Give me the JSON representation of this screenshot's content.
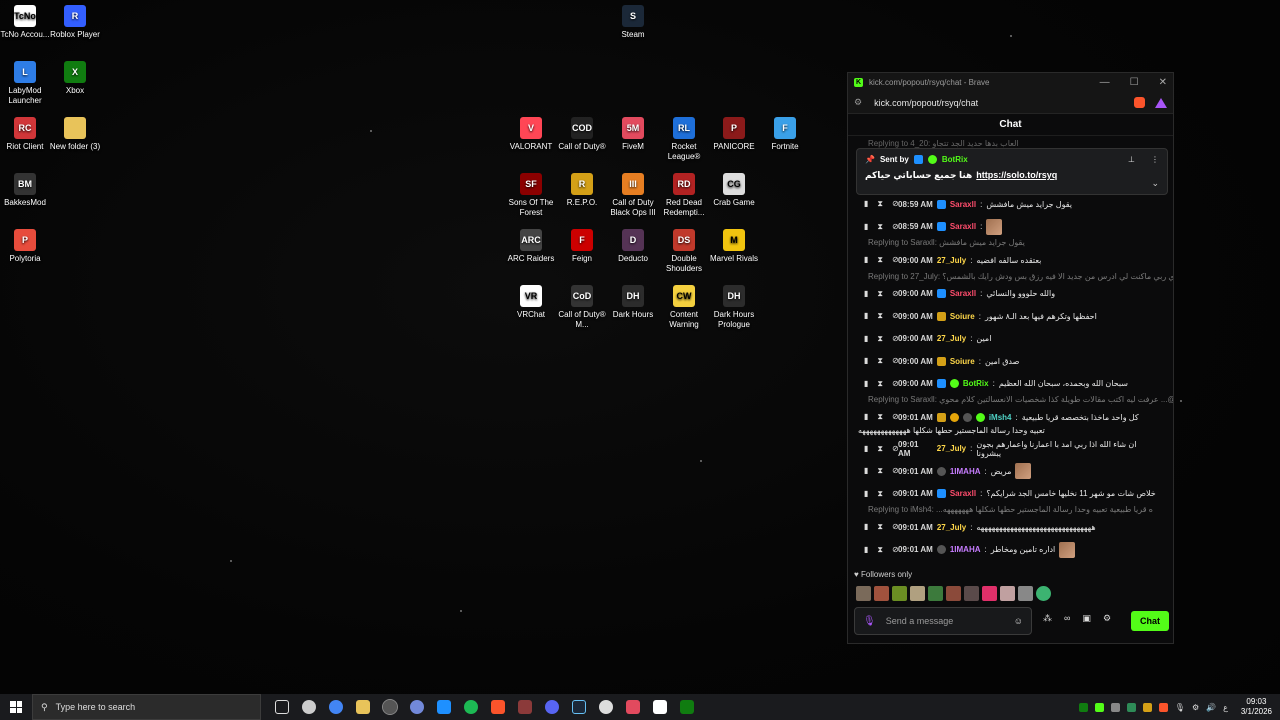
{
  "desktop": {
    "left_icons": [
      {
        "label": "TcNo Accou...",
        "color": "#ffffff",
        "txt": "TcNo",
        "icon": "tcno-icon"
      },
      {
        "label": "Roblox Player",
        "color": "#335fff",
        "txt": "R",
        "icon": "roblox-icon"
      },
      {
        "label": "LabyMod Launcher",
        "color": "#2e7de6",
        "txt": "L",
        "icon": "labymod-icon"
      },
      {
        "label": "Xbox",
        "color": "#107c10",
        "txt": "X",
        "icon": "xbox-icon"
      },
      {
        "label": "Riot Client",
        "color": "#d13639",
        "txt": "RC",
        "icon": "riot-icon"
      },
      {
        "label": "New folder (3)",
        "color": "#e8c35a",
        "txt": "",
        "icon": "folder-icon"
      },
      {
        "label": "BakkesMod",
        "color": "#333333",
        "txt": "BM",
        "icon": "bakkesmod-icon"
      },
      {
        "label": "Polytoria",
        "color": "#e74c3c",
        "txt": "P",
        "icon": "polytoria-icon"
      }
    ],
    "steam_icon": {
      "label": "Steam",
      "color": "#1b2838",
      "txt": "S",
      "icon": "steam-icon"
    },
    "grid_icons": [
      {
        "label": "VALORANT",
        "color": "#ff4655",
        "txt": "V",
        "icon": "valorant-icon"
      },
      {
        "label": "Call of Duty®",
        "color": "#222222",
        "txt": "COD",
        "icon": "cod-icon"
      },
      {
        "label": "FiveM",
        "color": "#e24a5e",
        "txt": "5M",
        "icon": "fivem-icon"
      },
      {
        "label": "Rocket League®",
        "color": "#1e6fd9",
        "txt": "RL",
        "icon": "rocket-league-icon"
      },
      {
        "label": "PANICORE",
        "color": "#8b1a1a",
        "txt": "P",
        "icon": "panicore-icon"
      },
      {
        "label": "Fortnite",
        "color": "#3aa0e8",
        "txt": "F",
        "icon": "fortnite-icon"
      },
      {
        "label": "Sons Of The Forest",
        "color": "#8b0000",
        "txt": "SF",
        "icon": "sons-forest-icon"
      },
      {
        "label": "R.E.P.O.",
        "color": "#d4a017",
        "txt": "R",
        "icon": "repo-icon"
      },
      {
        "label": "Call of Duty Black Ops III",
        "color": "#e67e22",
        "txt": "III",
        "icon": "bo3-icon"
      },
      {
        "label": "Red Dead Redempti...",
        "color": "#b22222",
        "txt": "RD",
        "icon": "rdr-icon"
      },
      {
        "label": "Crab Game",
        "color": "#dddddd",
        "txt": "CG",
        "icon": "crab-game-icon"
      },
      {
        "label": "ARC Raiders",
        "color": "#444444",
        "txt": "ARC",
        "icon": "arc-raiders-icon"
      },
      {
        "label": "Feign",
        "color": "#cc0000",
        "txt": "F",
        "icon": "feign-icon"
      },
      {
        "label": "Deducto",
        "color": "#553355",
        "txt": "D",
        "icon": "deducto-icon"
      },
      {
        "label": "Double Shoulders",
        "color": "#c0392b",
        "txt": "DS",
        "icon": "double-shoulders-icon"
      },
      {
        "label": "Marvel Rivals",
        "color": "#f1c40f",
        "txt": "M",
        "icon": "marvel-rivals-icon"
      },
      {
        "label": "VRChat",
        "color": "#ffffff",
        "txt": "VR",
        "icon": "vrchat-icon"
      },
      {
        "label": "Call of Duty® M...",
        "color": "#333333",
        "txt": "CoD",
        "icon": "cod-mw-icon"
      },
      {
        "label": "Dark Hours",
        "color": "#2c2c2c",
        "txt": "DH",
        "icon": "dark-hours-icon"
      },
      {
        "label": "Content Warning",
        "color": "#f4d03f",
        "txt": "CW",
        "icon": "content-warning-icon"
      },
      {
        "label": "Dark Hours Prologue",
        "color": "#2c2c2c",
        "txt": "DH",
        "icon": "dark-hours-prologue-icon"
      }
    ]
  },
  "window": {
    "title": "kick.com/popout/rsyq/chat - Brave",
    "url": "kick.com/popout/rsyq/chat",
    "chat_header": "Chat",
    "top_reply": "Replying to 4_20: العاب بدها حديد الجد تتجاو",
    "pinned": {
      "sent_by": "Sent by",
      "user": "BotRix",
      "text": "هنا جميع حساباتي حياكم",
      "link": "https://solo.to/rsyq"
    },
    "messages": [
      {
        "time": "08:59 AM",
        "user": "Saraxll",
        "color": "#ff4d6d",
        "text": "يقول جرايد ميش مافشش",
        "badges": [
          "s"
        ]
      },
      {
        "time": "08:59 AM",
        "user": "Saraxll",
        "color": "#ff4d6d",
        "text": "",
        "badges": [
          "s"
        ],
        "avatar": true
      },
      {
        "reply": "Replying to Saraxll: يقول جرايد ميش مافشش"
      },
      {
        "time": "09:00 AM",
        "user": "27_July",
        "color": "#ffd84a",
        "text": "بعتقده سالفه افضيه",
        "badges": []
      },
      {
        "reply": "Replying to 27_July: دي ربي ماكنت لي ادرس من جديد الا فيه رزق بس ودش رايك بالشمس؟ ..."
      },
      {
        "time": "09:00 AM",
        "user": "Saraxll",
        "color": "#ff4d6d",
        "text": "والله حلووو والنسائي",
        "badges": [
          "s"
        ]
      },
      {
        "time": "09:00 AM",
        "user": "Soiure",
        "color": "#ffd84a",
        "text": "احفظها وتكرهم فيها بعد الـ٨ شهور",
        "badges": [
          "c"
        ]
      },
      {
        "time": "09:00 AM",
        "user": "27_July",
        "color": "#ffd84a",
        "text": "امين",
        "badges": []
      },
      {
        "time": "09:00 AM",
        "user": "Soiure",
        "color": "#ffd84a",
        "text": "صدق امين",
        "badges": [
          "c"
        ]
      },
      {
        "time": "09:00 AM",
        "user": "BotRix",
        "color": "#53fc18",
        "text": "سبحان الله وبحمده، سبحان الله العظيم",
        "badges": [
          "s",
          "v"
        ]
      },
      {
        "reply": "Replying to Saraxll: عرفت ليه اكتب مقالات طويلة كذا شخصيات الانعسالتين كلام محوي ...@iM"
      },
      {
        "time": "09:01 AM",
        "user": "iMsh4",
        "color": "#4fd1c5",
        "text": "كل واحد ماخذا بتخصصه قريا طبيعية",
        "text2": "تعبيه وحدا رسالة الماجستير حطها شكلها هههههههههههههه",
        "badges": [
          "c",
          "g",
          "m",
          "v"
        ]
      },
      {
        "time": "09:01 AM",
        "user": "27_July",
        "color": "#ffd84a",
        "text": "ان شاء الله اذا ربي امد با اعمارنا واعمارهم بجون يبشرونا",
        "badges": []
      },
      {
        "time": "09:01 AM",
        "user": "1IMAHA",
        "color": "#c77dff",
        "text": "مريض",
        "badges": [
          "m"
        ],
        "avatar": true
      },
      {
        "time": "09:01 AM",
        "user": "Saraxll",
        "color": "#ff4d6d",
        "text": "خلاص شات مو شهر 11 نخليها خامس الجد شرايكم؟",
        "badges": [
          "s"
        ]
      },
      {
        "reply": "Replying to iMsh4: ...ه قريا طبيعية تعبيه وحدا رسالة الماجستير حطها شكلها هههههههه"
      },
      {
        "time": "09:01 AM",
        "user": "27_July",
        "color": "#ffd84a",
        "text": "هههههههههههههههههههههههههههههههه",
        "badges": []
      },
      {
        "time": "09:01 AM",
        "user": "1IMAHA",
        "color": "#c77dff",
        "text": "اداره تامين ومخاطر",
        "badges": [
          "m"
        ],
        "avatar": true
      }
    ],
    "followers_only": "Followers only",
    "input_placeholder": "Send a message",
    "chat_button": "Chat"
  },
  "taskbar": {
    "search_placeholder": "Type here to search",
    "time": "09:03",
    "date": "3/1/2026",
    "lang": "ع"
  }
}
